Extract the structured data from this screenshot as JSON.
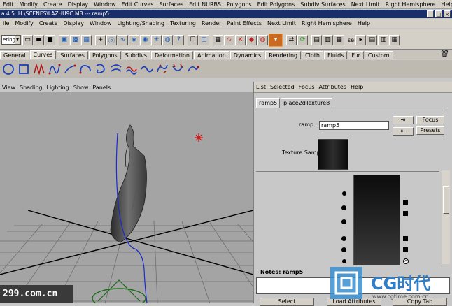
{
  "top_menu": [
    "Edit",
    "Modify",
    "Create",
    "Display",
    "Window",
    "Edit Curves",
    "Surfaces",
    "Edit NURBS",
    "Polygons",
    "Edit Polygons",
    "Subdiv Surfaces",
    "Next Limit",
    "Right Hemisphere",
    "Help"
  ],
  "maya_title": "a 4.5: H:\\SCENES\\LAZHU9C.MB   ---  ramp5",
  "window_buttons": [
    "_",
    "□",
    "×"
  ],
  "main_menu": [
    "ile",
    "Modify",
    "Create",
    "Display",
    "Window",
    "Lighting/Shading",
    "Texturing",
    "Render",
    "Paint Effects",
    "Next Limit",
    "Right Hemisphere",
    "Help"
  ],
  "mode_selector": "ering",
  "sel_label": "sel",
  "shelf_tabs": [
    "General",
    "Curves",
    "Surfaces",
    "Polygons",
    "Subdivs",
    "Deformation",
    "Animation",
    "Dynamics",
    "Rendering",
    "Cloth",
    "Fluids",
    "Fur",
    "Custom"
  ],
  "active_shelf_tab": "Curves",
  "panel_menu": [
    "View",
    "Shading",
    "Lighting",
    "Show",
    "Panels"
  ],
  "attr_editor": {
    "menu": [
      "List",
      "Selected",
      "Focus",
      "Attributes",
      "Help"
    ],
    "tabs": [
      "ramp5",
      "place2dTexture8"
    ],
    "ramp_label": "ramp:",
    "ramp_value": "ramp5",
    "focus_btn": "Focus",
    "presets_btn": "Presets",
    "texture_sample_label": "Texture Sample",
    "notes_label": "Notes: ramp5",
    "notes_value": "",
    "select_btn": "Select",
    "load_btn": "Load Attributes",
    "copy_tab_btn": "Copy Tab"
  },
  "watermark_left": "299.com.cn",
  "watermark_right_title": "CG时代",
  "watermark_right_url": "www.cgtime.com.cn",
  "colors": {
    "title_bar": "#1a2e6a",
    "viewport_bg": "#a4a4a4",
    "ui_bg": "#d4d0c8"
  }
}
